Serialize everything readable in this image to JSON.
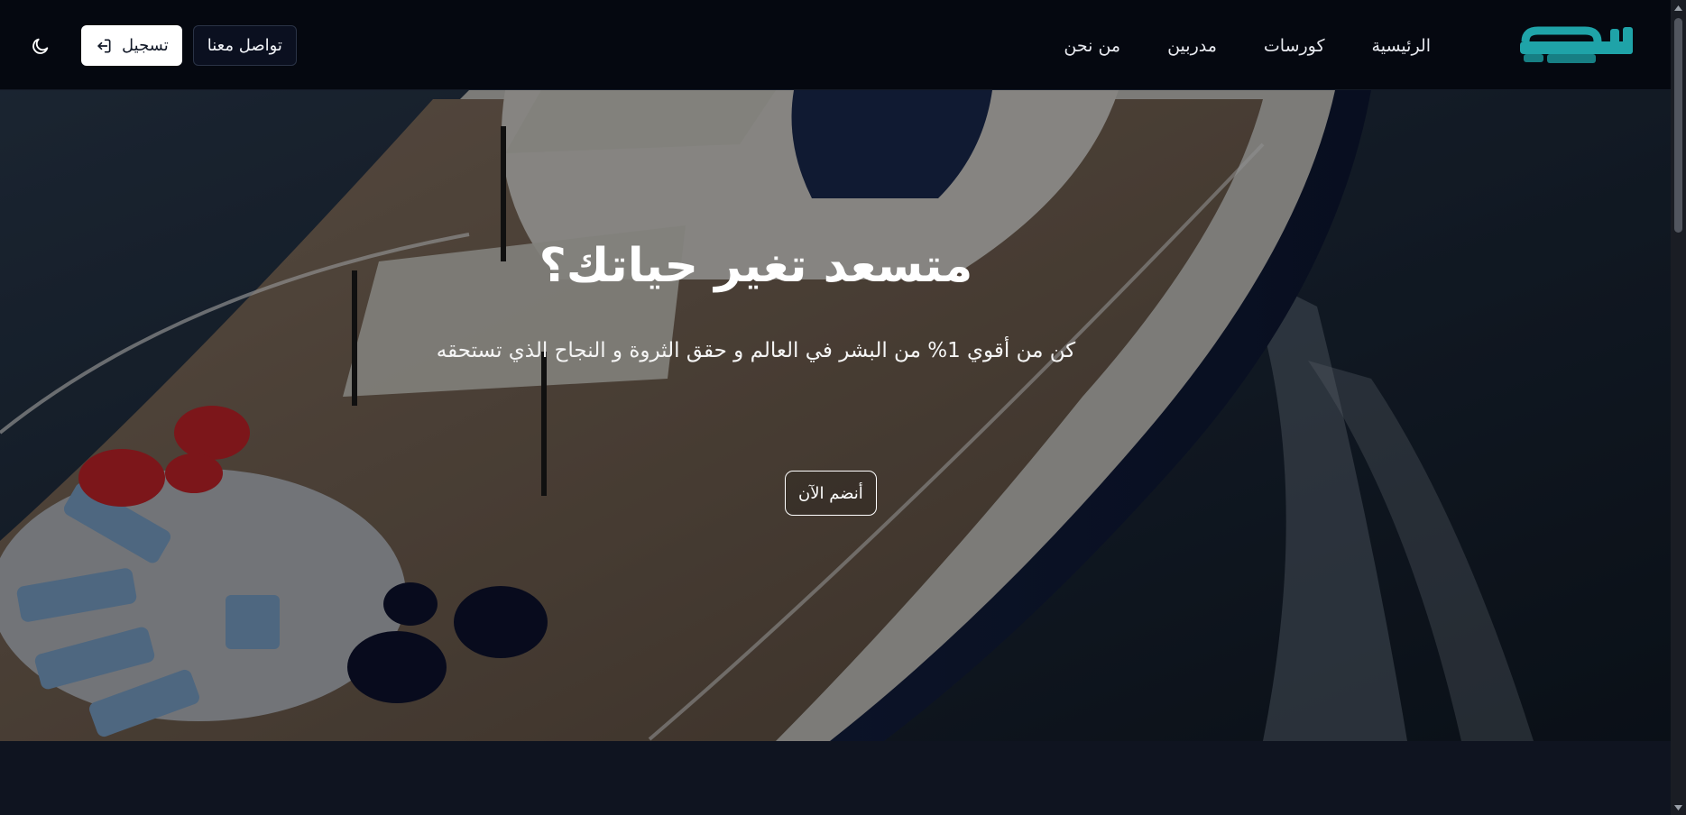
{
  "header": {
    "logo_alt": "ناجح",
    "nav": {
      "home": "الرئيسية",
      "courses": "كورسات",
      "trainers": "مدربين",
      "about": "من نحن"
    },
    "contact_label": "تواصل معنا",
    "login_label": "تسجيل"
  },
  "hero": {
    "title": "متسعد تغير حياتك؟",
    "subtitle": "كن من أقوي 1% من البشر في العالم و حقق الثروة و النجاح الذي تستحقه",
    "cta_label": "أنضم الآن"
  },
  "icons": {
    "theme": "moon-icon",
    "login": "login-arrow-icon"
  },
  "colors": {
    "brand": "#1fa3a8",
    "header_bg": "#050810",
    "page_bg": "#0f1420"
  }
}
